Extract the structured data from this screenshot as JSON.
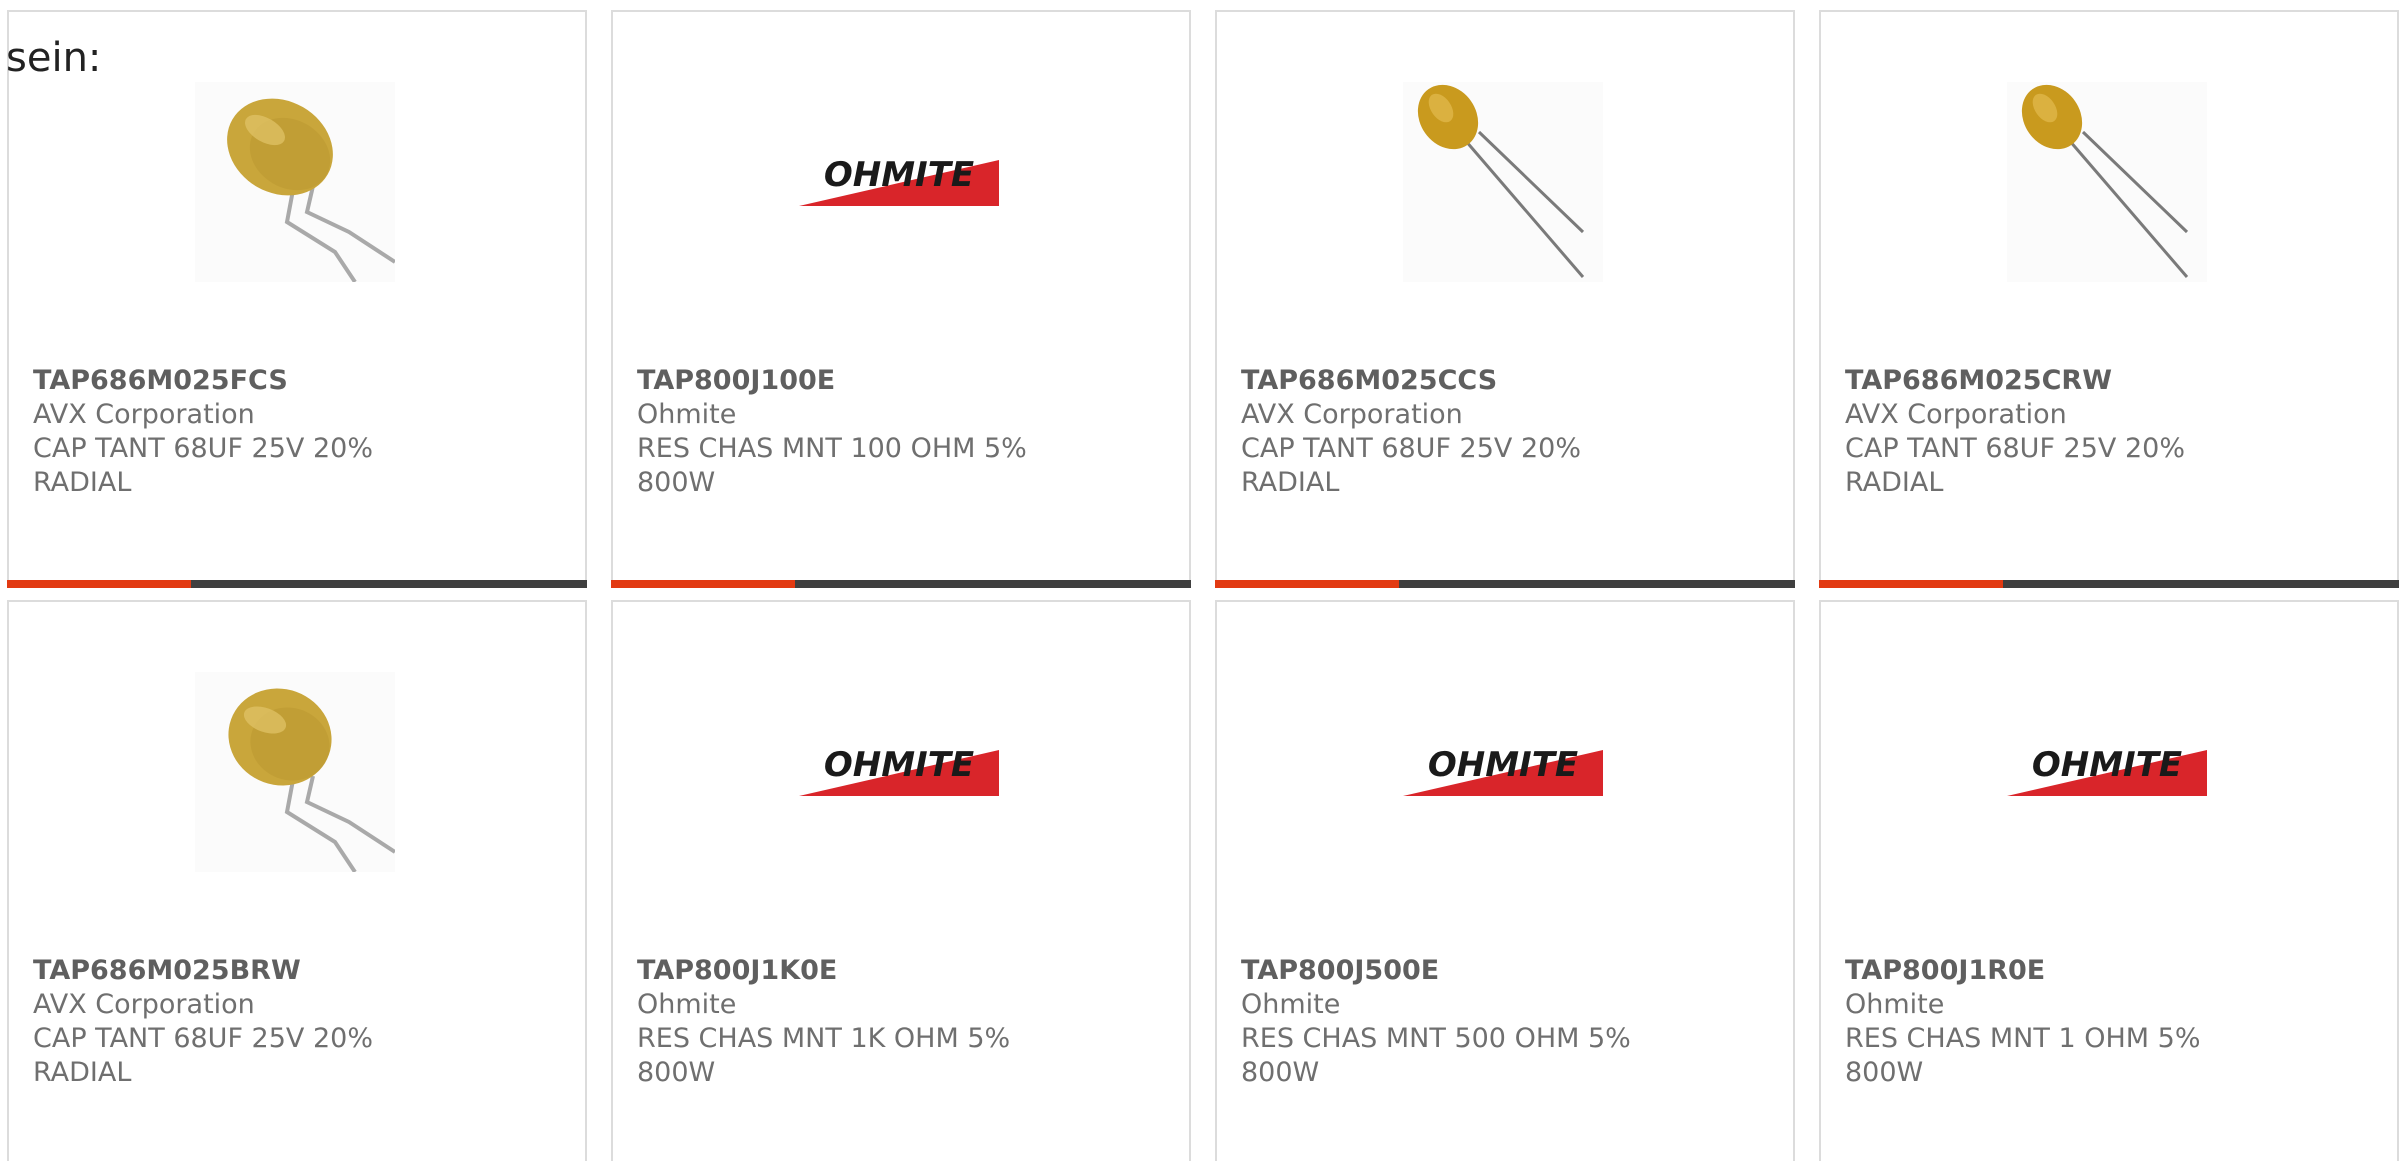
{
  "intro_text": "sein:",
  "colors": {
    "accent": "#e23a12",
    "bar_dark": "#3f3f3f",
    "ohmite_red": "#d9252a",
    "cap_gold": "#c9a63b"
  },
  "products": [
    {
      "part_number": "TAP686M025FCS",
      "manufacturer": "AVX Corporation",
      "description": "CAP TANT 68UF 25V 20% RADIAL",
      "image": "tantalum-capacitor-dipped",
      "logo_text": ""
    },
    {
      "part_number": "TAP800J100E",
      "manufacturer": "Ohmite",
      "description": "RES CHAS MNT 100 OHM 5% 800W",
      "image": "ohmite-logo",
      "logo_text": "OHMITE"
    },
    {
      "part_number": "TAP686M025CCS",
      "manufacturer": "AVX Corporation",
      "description": "CAP TANT 68UF 25V 20% RADIAL",
      "image": "tantalum-capacitor-bead",
      "logo_text": ""
    },
    {
      "part_number": "TAP686M025CRW",
      "manufacturer": "AVX Corporation",
      "description": "CAP TANT 68UF 25V 20% RADIAL",
      "image": "tantalum-capacitor-bead",
      "logo_text": ""
    },
    {
      "part_number": "TAP686M025BRW",
      "manufacturer": "AVX Corporation",
      "description": "CAP TANT 68UF 25V 20% RADIAL",
      "image": "tantalum-capacitor-dipped",
      "logo_text": ""
    },
    {
      "part_number": "TAP800J1K0E",
      "manufacturer": "Ohmite",
      "description": "RES CHAS MNT 1K OHM 5% 800W",
      "image": "ohmite-logo",
      "logo_text": "OHMITE"
    },
    {
      "part_number": "TAP800J500E",
      "manufacturer": "Ohmite",
      "description": "RES CHAS MNT 500 OHM 5% 800W",
      "image": "ohmite-logo",
      "logo_text": "OHMITE"
    },
    {
      "part_number": "TAP800J1R0E",
      "manufacturer": "Ohmite",
      "description": "RES CHAS MNT 1 OHM 5% 800W",
      "image": "ohmite-logo",
      "logo_text": "OHMITE"
    }
  ]
}
